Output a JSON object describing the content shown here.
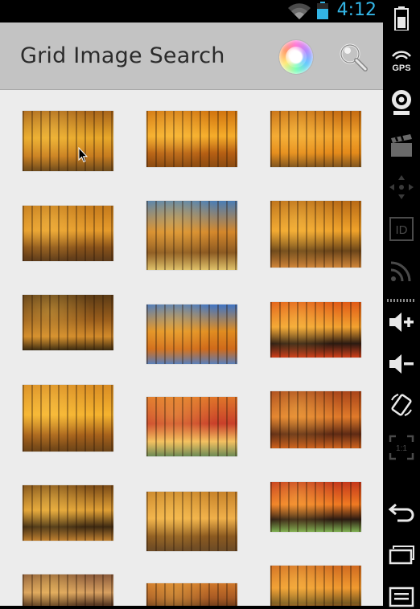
{
  "status_bar": {
    "time": "4:12"
  },
  "action_bar": {
    "title": "Grid Image Search",
    "icons": [
      "ball-icon",
      "search-icon"
    ]
  },
  "grid": {
    "description_items": [
      {
        "palette": [
          "#a8641a",
          "#e8a82a",
          "#c77c1f",
          "#6d4a1c"
        ]
      },
      {
        "palette": [
          "#d0730f",
          "#f6ad2a",
          "#b65f13",
          "#8a4b12"
        ]
      },
      {
        "palette": [
          "#c56b12",
          "#f2a52e",
          "#e48a1a",
          "#7f5520"
        ]
      },
      {
        "palette": [
          "#c47a1c",
          "#e69b2b",
          "#8a531a",
          "#5b3a1a"
        ]
      },
      {
        "palette": [
          "#4a7db5",
          "#d4872b",
          "#8c5a22",
          "#e0c26a"
        ]
      },
      {
        "palette": [
          "#b86a16",
          "#f0a32b",
          "#6b4519",
          "#d0863a"
        ]
      },
      {
        "palette": [
          "#5a3a15",
          "#9a5e1c",
          "#d28a2a",
          "#3a2a10"
        ]
      },
      {
        "palette": [
          "#3f74c5",
          "#e08c20",
          "#d06a1a",
          "#5b7fb8"
        ]
      },
      {
        "palette": [
          "#e05a16",
          "#f2a230",
          "#2b1a12",
          "#d0401a"
        ]
      },
      {
        "palette": [
          "#d88c24",
          "#f5b32e",
          "#a7621b",
          "#6a4318"
        ]
      },
      {
        "palette": [
          "#e0762a",
          "#c9402a",
          "#f3c060",
          "#6b8a55"
        ]
      },
      {
        "palette": [
          "#a8441a",
          "#e07a2a",
          "#5e2a14",
          "#d0641e"
        ]
      },
      {
        "palette": [
          "#7a4a16",
          "#e0a035",
          "#3e2a12",
          "#c08030"
        ]
      },
      {
        "palette": [
          "#c8832a",
          "#f0b04a",
          "#8c5a20",
          "#6a4a26"
        ]
      },
      {
        "palette": [
          "#c4381c",
          "#f07a22",
          "#2b1a12",
          "#7fb052"
        ]
      },
      {
        "palette": [
          "#8a5a3a",
          "#d8a060",
          "#5a3a24",
          "#b86a38"
        ]
      },
      {
        "palette": [
          "#d0782a",
          "#a85a24",
          "#6a3a1a",
          "#f0a040"
        ]
      },
      {
        "palette": [
          "#d06a20",
          "#f09a30",
          "#7a5a20",
          "#b84a1a"
        ]
      }
    ]
  },
  "side_panel": {
    "buttons": [
      "battery-icon",
      "gps-icon",
      "webcam-icon",
      "clapper-icon",
      "dpad-icon",
      "id-icon",
      "wifi-signal-icon",
      "volume-up-icon",
      "volume-down-icon",
      "rotate-icon",
      "scale-icon",
      "back-icon",
      "recent-apps-icon",
      "menu-icon"
    ],
    "gps_label": "GPS",
    "id_label": "ID",
    "scale_label": "1:1"
  }
}
